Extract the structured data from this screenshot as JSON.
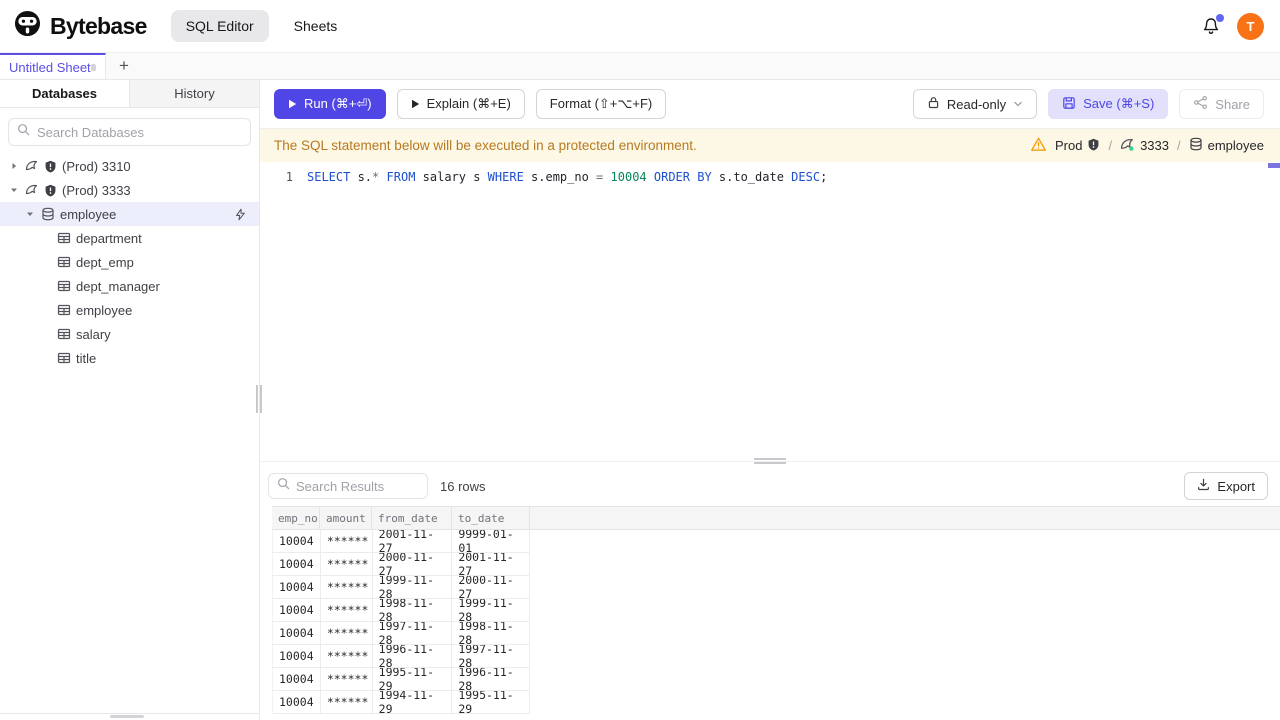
{
  "colors": {
    "accent": "#4f46e5",
    "tab_accent": "#5b4ee4",
    "warning_bg": "#fdf8e6",
    "warning_text": "#b7791f",
    "warning_icon": "#f59e0b",
    "avatar_bg": "#f97316",
    "keyword": "#1e4fcf",
    "number": "#098658",
    "selected_row_bg": "#eceefb"
  },
  "header": {
    "brand": "Bytebase",
    "nav": [
      {
        "label": "SQL Editor",
        "active": true
      },
      {
        "label": "Sheets",
        "active": false
      }
    ],
    "avatar_initial": "T"
  },
  "sheet_tabs": {
    "active_label": "Untitled Sheet",
    "add_label": "+"
  },
  "sidebar": {
    "tabs": [
      "Databases",
      "History"
    ],
    "search_placeholder": "Search Databases",
    "tree": [
      {
        "label": "(Prod) 3310",
        "type": "instance",
        "depth": 0,
        "caret": "right",
        "selected": false,
        "bolt": false
      },
      {
        "label": "(Prod) 3333",
        "type": "instance",
        "depth": 0,
        "caret": "down",
        "selected": false,
        "bolt": false
      },
      {
        "label": "employee",
        "type": "database",
        "depth": 1,
        "caret": "down",
        "selected": true,
        "bolt": true
      },
      {
        "label": "department",
        "type": "table",
        "depth": 2,
        "caret": "none",
        "selected": false,
        "bolt": false
      },
      {
        "label": "dept_emp",
        "type": "table",
        "depth": 2,
        "caret": "none",
        "selected": false,
        "bolt": false
      },
      {
        "label": "dept_manager",
        "type": "table",
        "depth": 2,
        "caret": "none",
        "selected": false,
        "bolt": false
      },
      {
        "label": "employee",
        "type": "table",
        "depth": 2,
        "caret": "none",
        "selected": false,
        "bolt": false
      },
      {
        "label": "salary",
        "type": "table",
        "depth": 2,
        "caret": "none",
        "selected": false,
        "bolt": false
      },
      {
        "label": "title",
        "type": "table",
        "depth": 2,
        "caret": "none",
        "selected": false,
        "bolt": false
      }
    ]
  },
  "toolbar": {
    "run_label": "Run (⌘+⏎)",
    "explain_label": "Explain (⌘+E)",
    "format_label": "Format (⇧+⌥+F)",
    "readonly_label": "Read-only",
    "save_label": "Save (⌘+S)",
    "share_label": "Share"
  },
  "banner": {
    "message": "The SQL statement below will be executed in a protected environment.",
    "environment": "Prod",
    "instance": "3333",
    "database": "employee"
  },
  "editor": {
    "line_number": "1",
    "sql": "SELECT s.* FROM salary s WHERE s.emp_no = 10004 ORDER BY s.to_date DESC;",
    "tokens": [
      {
        "text": "SELECT",
        "type": "kw"
      },
      {
        "text": " s.",
        "type": "id"
      },
      {
        "text": "*",
        "type": "op"
      },
      {
        "text": " ",
        "type": "id"
      },
      {
        "text": "FROM",
        "type": "kw"
      },
      {
        "text": " salary s ",
        "type": "id"
      },
      {
        "text": "WHERE",
        "type": "kw"
      },
      {
        "text": " s.emp_no ",
        "type": "id"
      },
      {
        "text": "=",
        "type": "op"
      },
      {
        "text": " ",
        "type": "id"
      },
      {
        "text": "10004",
        "type": "num"
      },
      {
        "text": " ",
        "type": "id"
      },
      {
        "text": "ORDER BY",
        "type": "kw"
      },
      {
        "text": " s.to_date ",
        "type": "id"
      },
      {
        "text": "DESC",
        "type": "kw"
      },
      {
        "text": ";",
        "type": "id"
      }
    ]
  },
  "results": {
    "search_placeholder": "Search Results",
    "row_count": "16 rows",
    "export_label": "Export",
    "columns": [
      "emp_no",
      "amount",
      "from_date",
      "to_date"
    ],
    "rows": [
      [
        "10004",
        "******",
        "2001-11-27",
        "9999-01-01"
      ],
      [
        "10004",
        "******",
        "2000-11-27",
        "2001-11-27"
      ],
      [
        "10004",
        "******",
        "1999-11-28",
        "2000-11-27"
      ],
      [
        "10004",
        "******",
        "1998-11-28",
        "1999-11-28"
      ],
      [
        "10004",
        "******",
        "1997-11-28",
        "1998-11-28"
      ],
      [
        "10004",
        "******",
        "1996-11-28",
        "1997-11-28"
      ],
      [
        "10004",
        "******",
        "1995-11-29",
        "1996-11-28"
      ],
      [
        "10004",
        "******",
        "1994-11-29",
        "1995-11-29"
      ]
    ]
  }
}
